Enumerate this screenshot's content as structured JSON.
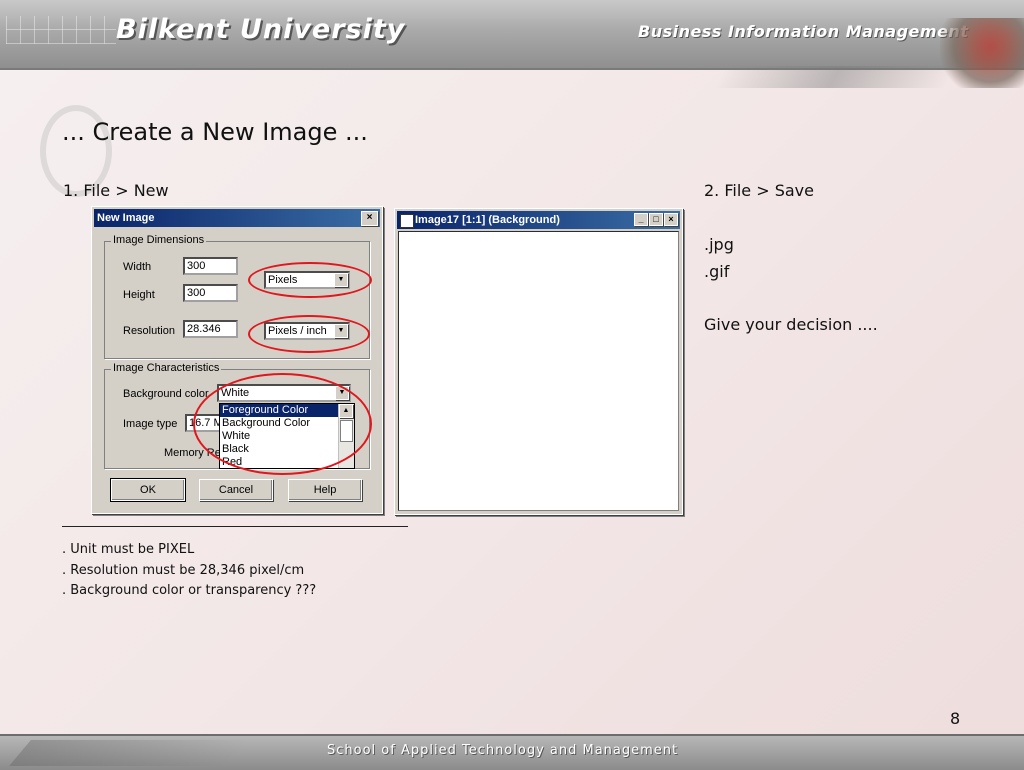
{
  "header": {
    "university": "Bilkent University",
    "department": "Business Information Management"
  },
  "slide": {
    "title": "... Create a New Image ...",
    "step1": "1. File > New",
    "step2": "2. File > Save",
    "formats": [
      ".jpg",
      ".gif"
    ],
    "decision": "Give your decision ....",
    "notes": [
      ". Unit must be PIXEL",
      ". Resolution must be 28,346 pixel/cm",
      ". Background color or transparency ???"
    ],
    "page_number": "8"
  },
  "dialog": {
    "title": "New Image",
    "close": "×",
    "dimensions_group": "Image Dimensions",
    "width_label": "Width",
    "width_value": "300",
    "height_label": "Height",
    "height_value": "300",
    "size_unit": "Pixels",
    "resolution_label": "Resolution",
    "resolution_value": "28.346",
    "resolution_unit": "Pixels / inch",
    "characteristics_group": "Image Characteristics",
    "bg_label": "Background color",
    "bg_value": "White",
    "type_label": "Image type",
    "type_value": "16.7 M",
    "memory_label": "Memory Re",
    "bg_options": [
      "Foreground Color",
      "Background Color",
      "White",
      "Black",
      "Red"
    ],
    "ok": "OK",
    "cancel": "Cancel",
    "help": "Help"
  },
  "image_window": {
    "title": "Image17 [1:1] (Background)",
    "min": "_",
    "max": "□",
    "close": "×"
  },
  "footer": {
    "text": "School of Applied Technology and Management"
  }
}
